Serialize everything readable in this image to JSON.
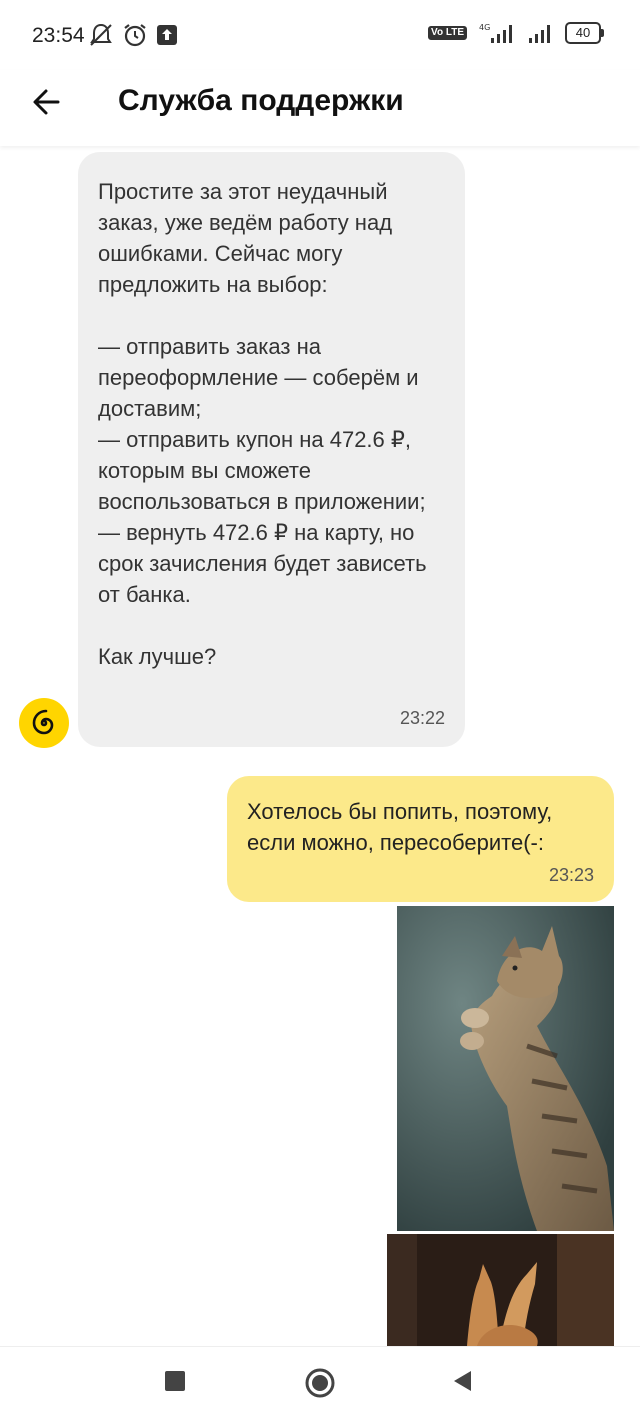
{
  "status_bar": {
    "time": "23:54",
    "lte_label": "Vo LTE",
    "network": "4G",
    "battery": "40"
  },
  "header": {
    "title": "Служба поддержки",
    "back_icon": "arrow-left-icon"
  },
  "messages": [
    {
      "from": "support",
      "text": "Простите за этот неудачный заказ, уже ведём работу над ошибками. Сейчас могу предложить на выбор:\n\n— отправить заказ на переоформление — соберём и доставим;\n— отправить купон на 472.6 ₽, которым вы сможете воспользоваться в приложении;\n— вернуть 472.6 ₽ на карту, но срок зачисления будет зависеть от банка.\n\nКак лучше?",
      "time": "23:22"
    },
    {
      "from": "user",
      "text": "Хотелось бы попить, поэтому, если можно, пересоберите(-:",
      "time": "23:23"
    }
  ],
  "attachments": [
    "cat-photo",
    "cat-photo"
  ],
  "colors": {
    "incoming_bubble": "#efefef",
    "outgoing_bubble": "#fce98a",
    "avatar": "#ffd500"
  },
  "nav": [
    "recent-apps-icon",
    "home-icon",
    "back-icon"
  ]
}
